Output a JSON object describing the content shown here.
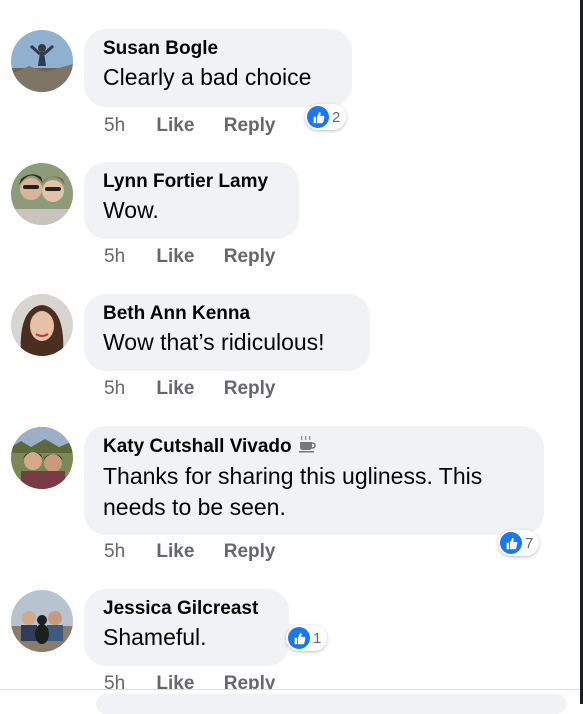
{
  "comments": [
    {
      "author": "Susan Bogle",
      "text": "Clearly a bad choice",
      "time": "5h",
      "like_label": "Like",
      "reply_label": "Reply",
      "reaction_count": "2",
      "avatar_icon": "avatar-photo"
    },
    {
      "author": "Lynn Fortier Lamy",
      "text": "Wow.",
      "time": "5h",
      "like_label": "Like",
      "reply_label": "Reply",
      "avatar_icon": "avatar-photo"
    },
    {
      "author": "Beth Ann Kenna",
      "text": "Wow that’s ridiculous!",
      "time": "5h",
      "like_label": "Like",
      "reply_label": "Reply",
      "avatar_icon": "avatar-photo"
    },
    {
      "author": "Katy Cutshall Vivado",
      "text": "Thanks for sharing this ugliness. This needs to be seen.",
      "time": "5h",
      "like_label": "Like",
      "reply_label": "Reply",
      "reaction_count": "7",
      "badge_icon": "coffee-cup-icon",
      "avatar_icon": "avatar-photo"
    },
    {
      "author": "Jessica Gilcreast",
      "text": "Shameful.",
      "time": "5h",
      "like_label": "Like",
      "reply_label": "Reply",
      "reaction_count": "1",
      "avatar_icon": "avatar-photo"
    }
  ],
  "colors": {
    "bubble": "#f0f2f5",
    "like_blue": "#1877f2",
    "meta_gray": "#65676b"
  }
}
